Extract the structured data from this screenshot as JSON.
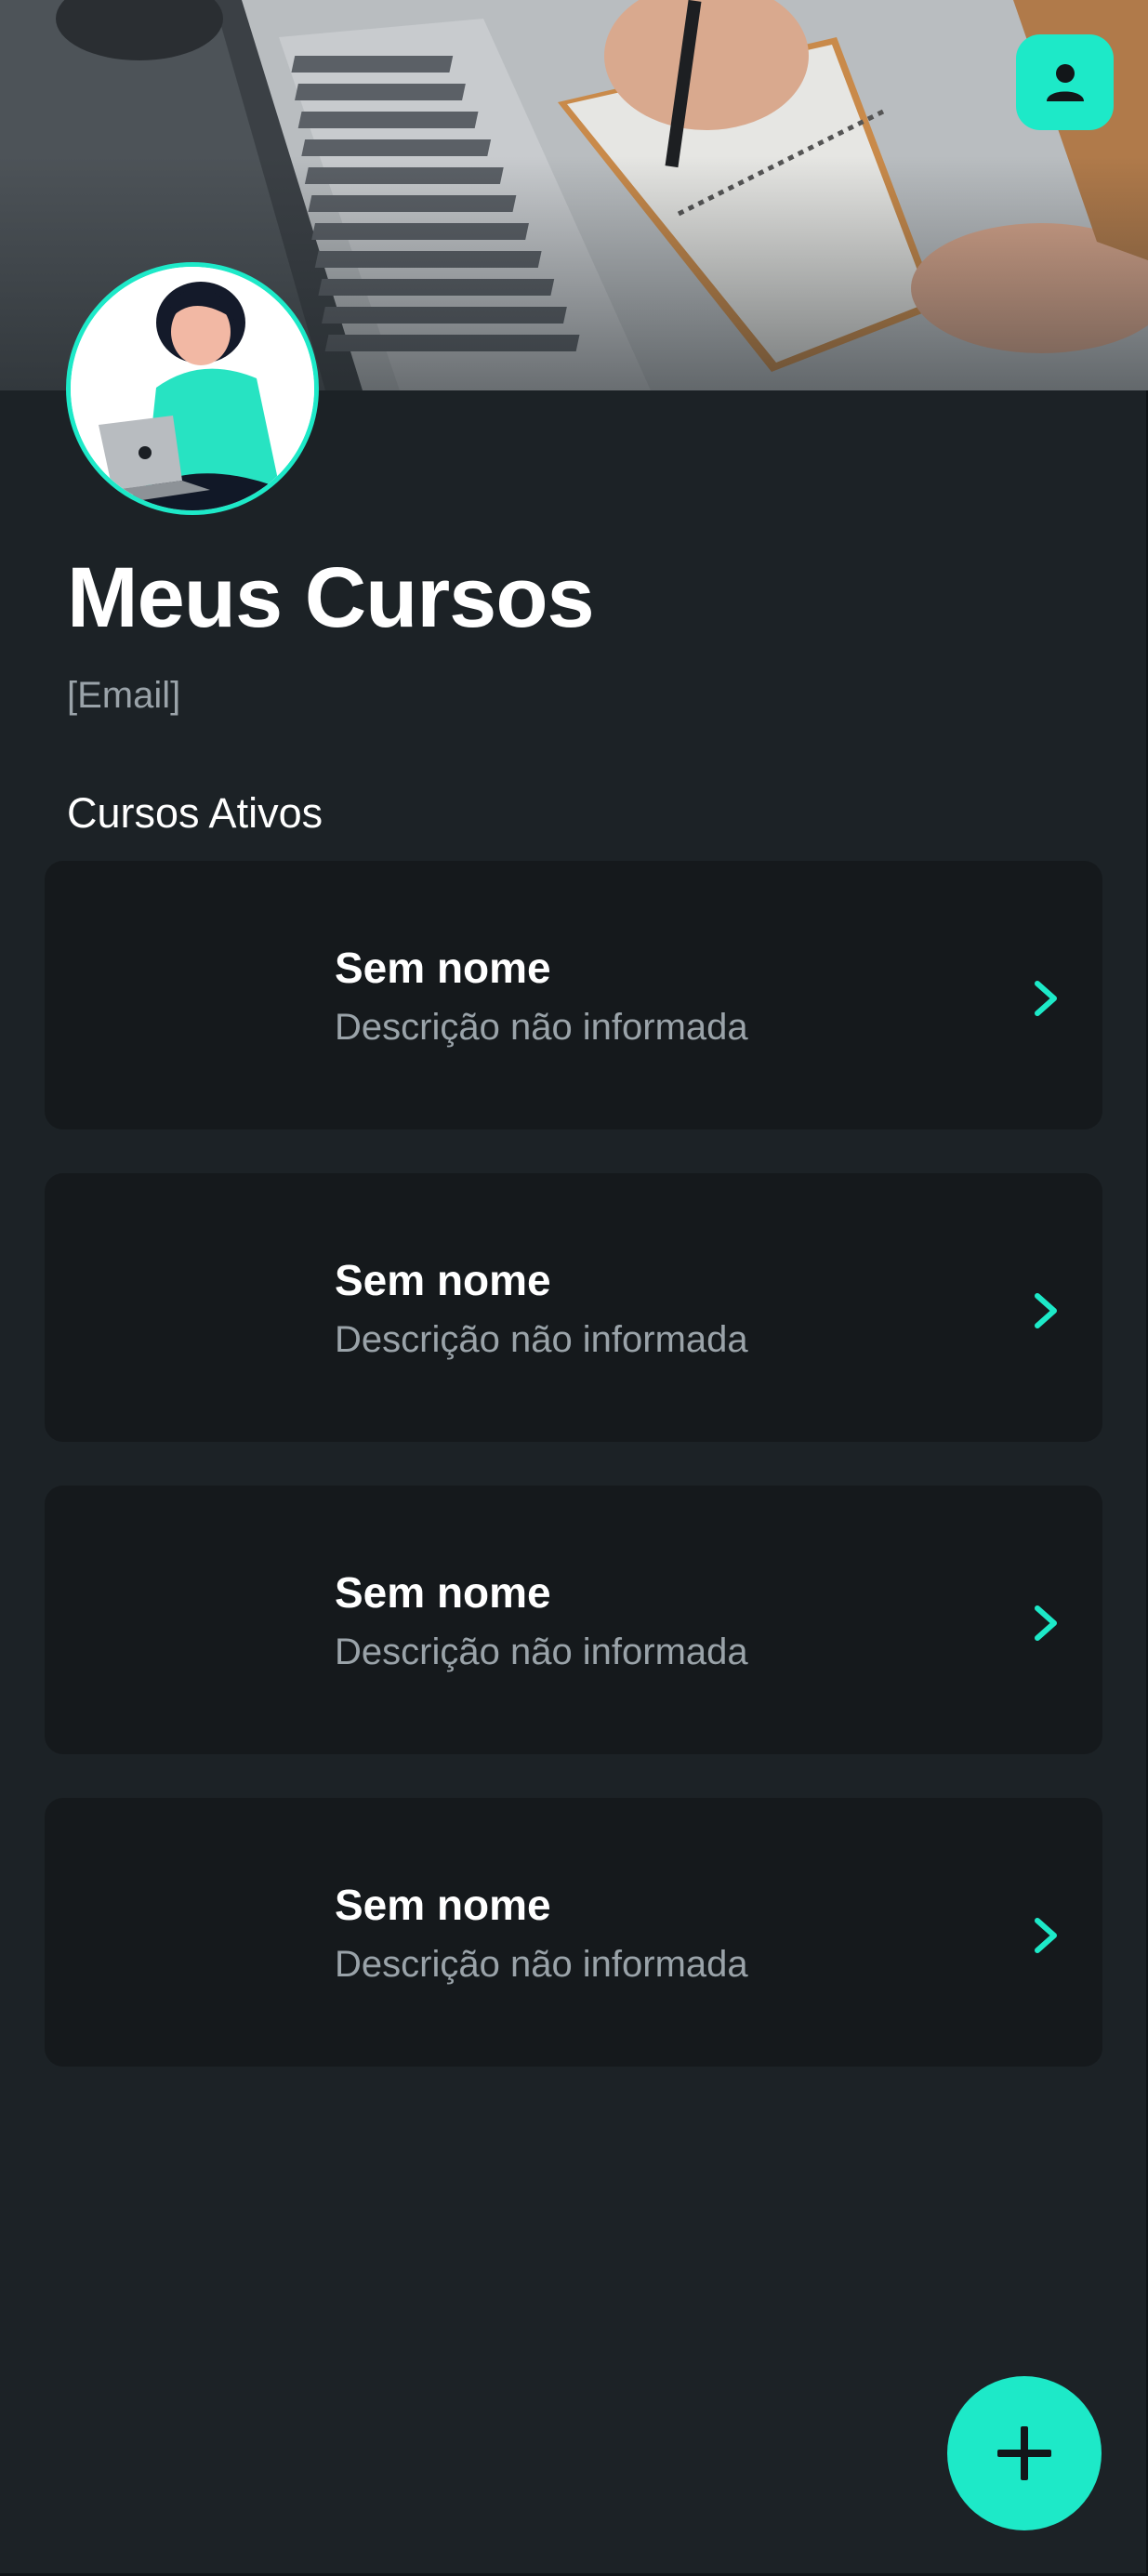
{
  "header": {
    "banner_image": "laptop-notebook-photo",
    "profile_icon": "person-icon"
  },
  "profile": {
    "avatar": "woman-with-laptop-illustration",
    "title": "Meus Cursos",
    "email": "[Email]"
  },
  "section": {
    "title": "Cursos Ativos"
  },
  "courses": [
    {
      "name": "Sem nome",
      "description": "Descrição não informada"
    },
    {
      "name": "Sem nome",
      "description": "Descrição não informada"
    },
    {
      "name": "Sem nome",
      "description": "Descrição não informada"
    },
    {
      "name": "Sem nome",
      "description": "Descrição não informada"
    }
  ],
  "fab": {
    "icon": "plus-icon"
  },
  "colors": {
    "accent": "#1de9c8",
    "background": "#1c2226",
    "card": "#15191c",
    "muted_text": "#9aa3a9"
  }
}
